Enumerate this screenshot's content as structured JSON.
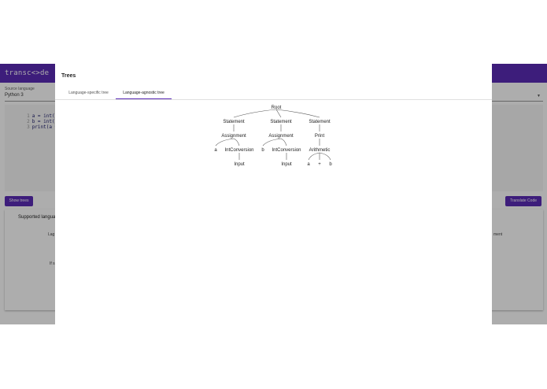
{
  "app": {
    "title": "transc<>de",
    "source_language_label": "Source language",
    "source_language_value": "Python 3",
    "code_lines": [
      {
        "num": "1",
        "text": "a = int(input("
      },
      {
        "num": "2",
        "text": "b = int(input("
      },
      {
        "num": "3",
        "text": "print(a + b)"
      }
    ],
    "show_trees_label": "Show trees",
    "translate_label": "Translate Code",
    "card": {
      "title": "Supported langua",
      "fragment_1": "Lag",
      "fragment_2": "ment",
      "fragment_3": "If s"
    }
  },
  "dialog": {
    "title": "Trees",
    "tabs": [
      {
        "label": "Language-specific tree",
        "active": false
      },
      {
        "label": "Language-agnostic tree",
        "active": true
      }
    ],
    "tree_nodes": {
      "root": "Root",
      "stmt1": "Statement",
      "stmt2": "Statement",
      "stmt3": "Statement",
      "assign1": "Assignment",
      "assign2": "Assignment",
      "print": "Print",
      "var_a": "a",
      "intconv1": "IntConversion",
      "var_b": "b",
      "intconv2": "IntConversion",
      "arith": "Arithmetic",
      "input1": "Input",
      "input2": "Input",
      "arith_a": "a",
      "arith_op": "+",
      "arith_b": "b"
    }
  },
  "colors": {
    "primary": "#5b2bb5",
    "scrim": "rgba(0,0,0,0.32)"
  }
}
